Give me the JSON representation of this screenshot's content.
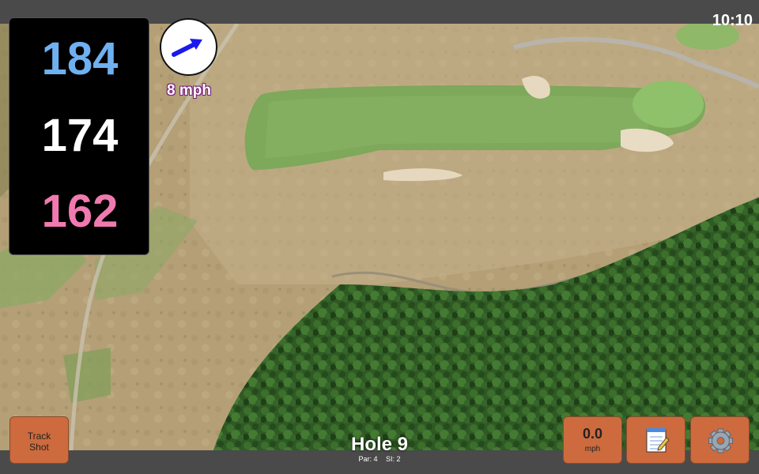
{
  "status": {
    "time": "10:10"
  },
  "distances": {
    "back": "184",
    "middle": "174",
    "front": "162"
  },
  "wind": {
    "speed_text": "8 mph",
    "icon": "wind-arrow-icon"
  },
  "hole": {
    "title": "Hole 9",
    "par": "Par: 4",
    "stroke_index": "SI: 2"
  },
  "buttons": {
    "track_shot": "Track\nShot",
    "speed_value": "0.0",
    "speed_unit": "mph",
    "notes_icon": "notepad-icon",
    "settings_icon": "gear-icon"
  },
  "colors": {
    "back": "#6fb0f0",
    "middle": "#ffffff",
    "front": "#f07ab0",
    "button": "#cd6b3e"
  }
}
